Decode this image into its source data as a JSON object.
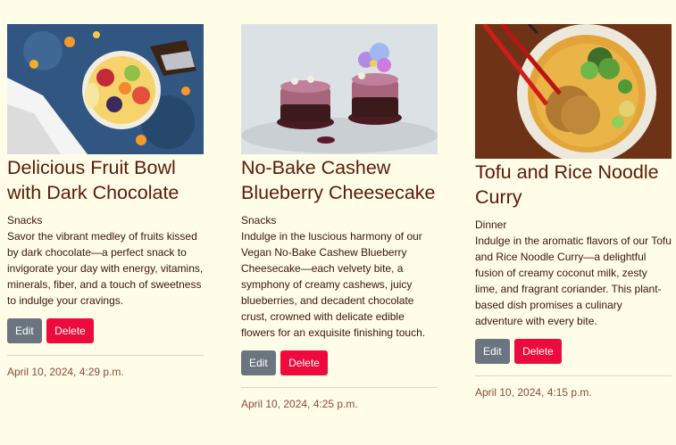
{
  "cards": [
    {
      "image_label": "fruit bowl photo",
      "title": "Delicious Fruit Bowl with Dark Chocolate",
      "category": "Snacks",
      "description": "Savor the vibrant medley of fruits kissed by dark chocolate—a perfect snack to invigorate your day with energy, vitamins, minerals, fiber, and a touch of sweetness to indulge your cravings.",
      "edit_label": "Edit",
      "delete_label": "Delete",
      "date": "April 10, 2024, 4:29 p.m."
    },
    {
      "image_label": "cheesecake photo",
      "title": "No-Bake Cashew Blueberry Cheesecake",
      "category": "Snacks",
      "description": "Indulge in the luscious harmony of our Vegan No-Bake Cashew Blueberry Cheesecake—each velvety bite, a symphony of creamy cashews, juicy blueberries, and decadent chocolate crust, crowned with delicate edible flowers for an exquisite finishing touch.",
      "edit_label": "Edit",
      "delete_label": "Delete",
      "date": "April 10, 2024, 4:25 p.m."
    },
    {
      "image_label": "noodle curry photo",
      "title": "Tofu and Rice Noodle Curry",
      "category": "Dinner",
      "description": "Indulge in the aromatic flavors of our Tofu and Rice Noodle Curry—a delightful fusion of creamy coconut milk, zesty lime, and fragrant coriander. This plant-based dish promises a culinary adventure with every bite.",
      "edit_label": "Edit",
      "delete_label": "Delete",
      "date": "April 10, 2024, 4:15 p.m."
    }
  ],
  "colors": {
    "background": "#fffde8",
    "title": "#5a1a06",
    "edit_button": "#6b7580",
    "delete_button": "#ee0a3c",
    "date": "#8a4a35"
  }
}
